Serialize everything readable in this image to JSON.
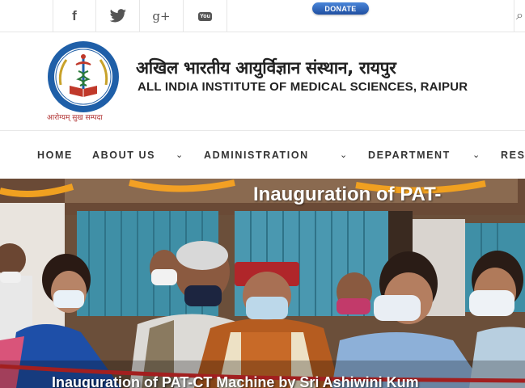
{
  "topbar": {
    "social": [
      {
        "name": "facebook-icon",
        "glyph": "f"
      },
      {
        "name": "twitter-icon"
      },
      {
        "name": "google-plus-icon",
        "glyph": "g+"
      },
      {
        "name": "youtube-icon",
        "glyph": "You"
      }
    ],
    "donate_label": "DONATE",
    "search_icon": "search-icon"
  },
  "header": {
    "hindi_name": "अखिल भारतीय आयुर्विज्ञान संस्थान, रायपुर",
    "english_name": "ALL INDIA INSTITUTE OF MEDICAL SCIENCES, RAIPUR",
    "motto": "आरोग्यम् सुख सम्पदा"
  },
  "nav": {
    "items": [
      {
        "label": "HOME"
      },
      {
        "label": "ABOUT US"
      },
      {
        "label": "ADMINISTRATION"
      },
      {
        "label": "DEPARTMENT"
      },
      {
        "label": "RES"
      }
    ],
    "chevron": "⌄"
  },
  "hero": {
    "title": "Inauguration of PAT-",
    "caption": "Inauguration of PAT-CT Machine by Sri Ashiwini Kum"
  },
  "colors": {
    "logo_blue": "#1f5fa8",
    "logo_red": "#c0392b",
    "donate_blue": "#2a5db0"
  }
}
